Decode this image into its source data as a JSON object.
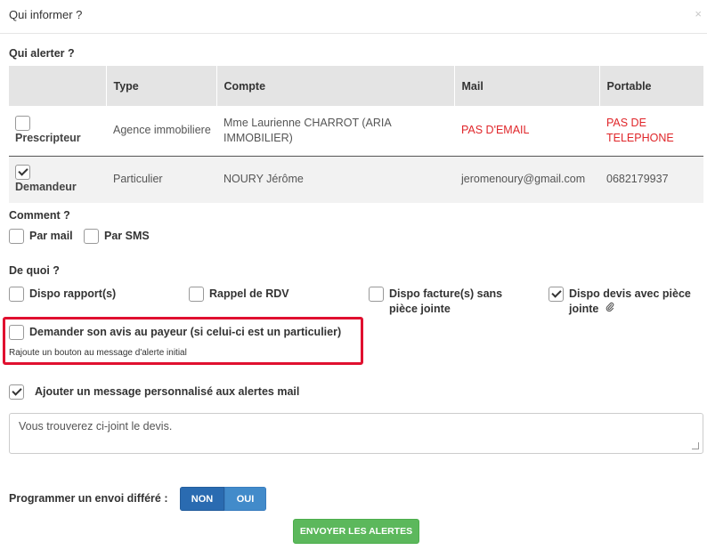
{
  "modal": {
    "title": "Qui informer ?",
    "close": "×"
  },
  "sections": {
    "who": "Qui alerter ?",
    "how": "Comment ?",
    "what": "De quoi ?",
    "schedule": "Programmer un envoi différé :"
  },
  "table": {
    "headers": [
      "",
      "Type",
      "Compte",
      "Mail",
      "Portable"
    ],
    "rows": [
      {
        "role": "Prescripteur",
        "checked": false,
        "type": "Agence immobiliere",
        "account": "Mme Laurienne CHARROT (ARIA IMMOBILIER)",
        "mail": "PAS D'EMAIL",
        "phone": "PAS DE TELEPHONE"
      },
      {
        "role": "Demandeur",
        "checked": true,
        "type": "Particulier",
        "account": "NOURY Jérôme",
        "mail": "jeromenoury@gmail.com",
        "phone": "0682179937"
      }
    ]
  },
  "how": {
    "mail": "Par mail",
    "sms": "Par SMS"
  },
  "what": {
    "report": "Dispo rapport(s)",
    "rdv": "Rappel de RDV",
    "invoice": "Dispo facture(s) sans pièce jointe",
    "quote": "Dispo devis avec pièce jointe"
  },
  "feedback": {
    "label": "Demander son avis au payeur (si celui-ci est un particulier)",
    "hint": "Rajoute un bouton au message d'alerte initial"
  },
  "custom_message": {
    "label": "Ajouter un message personnalisé aux alertes mail",
    "value": "Vous trouverez ci-joint le devis."
  },
  "toggle": {
    "no": "NON",
    "yes": "OUI"
  },
  "send_label": "ENVOYER LES ALERTES",
  "icons": {
    "paperclip": "paperclip-icon",
    "close": "close-icon"
  }
}
